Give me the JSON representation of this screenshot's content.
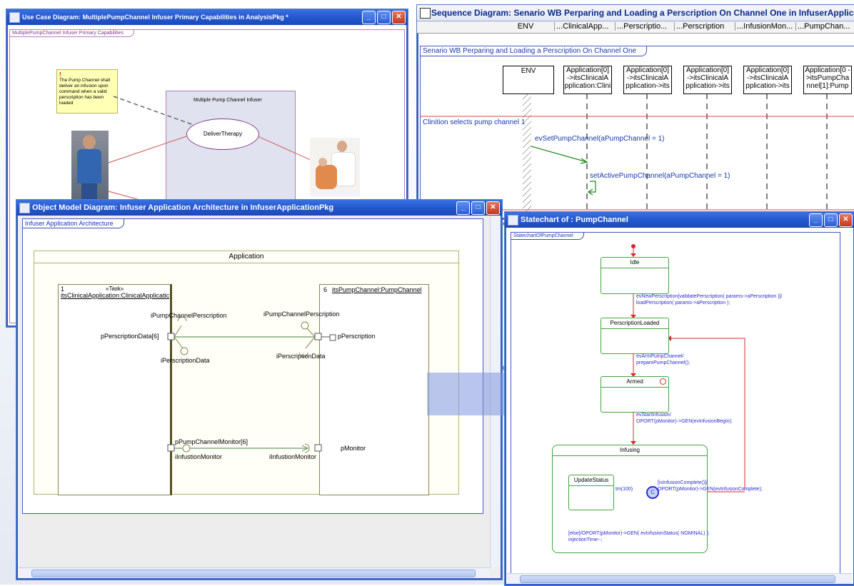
{
  "usecase": {
    "title": "Use Case Diagram: MultiplePumpChannel Infuser Primary Capabilities in AnalysisPkg *",
    "frame_label": "MultiplePumpChannel Infuser Primary Capabilities",
    "note": "The Pump Channel shall deliver an infusion upon command when a valid perscription has been loaded",
    "system_label": "Multiple Pump Channel Infuser",
    "usecase_label": "DeliverTherapy"
  },
  "sequence": {
    "title": "Sequence Diagram: Senario WB Perparing and Loading a Perscription On Channel One in InfuserApplicat",
    "header_cols": [
      "ENV",
      "...ClinicalApp...",
      "...Perscriptio...",
      "...Perscription",
      "...InfusionMon...",
      "...PumpChan..."
    ],
    "frame_label": "Senario WB Perparing and Loading a Perscription On Channel One",
    "env": "ENV",
    "lifelines": [
      "Application[0] ->itsClinicalA pplication:Clini",
      "Application[0] ->itsClinicalA pplication->its",
      "Application[0] ->itsClinicalA pplication->its",
      "Application[0] ->itsClinicalA pplication->its",
      "Application[0 ->itsPumpCha nnel[1]:Pump"
    ],
    "condition": "Clinition selects pump channel 1",
    "msg1": "evSetPumpChannel(aPumpChannel = 1)",
    "msg2": "setActivePumpChannel(aPumpChannel = 1)",
    "stub1": "tio",
    "stub2": "rip"
  },
  "objectmodel": {
    "title": "Object Model Diagram: Infuser Application Architecture in InfuserApplicationPkg",
    "frame_label": "Infuser Application Architecture",
    "app_label": "Application",
    "left_mult": "1",
    "left_stereo": "«Task»",
    "left_name": "itsClinicalApplication:ClinicalApplicatic",
    "right_mult": "6",
    "right_name": "itsPumpChannel:PumpChannel",
    "iPumpL": "iPumpChannelPerscription",
    "iPumpR": "iPumpChannelPerscription",
    "pPersData": "pPerscriptionData[6]",
    "iPersData": "iPerscriptionData",
    "iPerscriptionData": "iPerscriptionData",
    "pPerscription": "pPerscription",
    "pMonitorL": "pPumpChannelMonitor[6]",
    "iInfL": "iInfustionMonitor",
    "iInfR": "iInfustionMonitor",
    "pMonitor": "pMonitor"
  },
  "statechart": {
    "title": "Statechart of : PumpChannel",
    "frame_label": "StatechartOfPumpChannel",
    "s_idle": "Idle",
    "s_loaded": "PerscriptionLoaded",
    "s_armed": "Armed",
    "s_infusing": "Infusing",
    "s_update": "UpdateStatus",
    "t1a": "evNewPerscription[validatePerscription( params->aPerscription )]/",
    "t1b": "loadPerscription( params->aPerscription );",
    "t2a": "evArmPumpChannel/",
    "t2b": "preparePumpChannel();",
    "t3a": "evStartInfusion/",
    "t3b": "OPORT(pMonitor)->GEN(evInfusionBegin);",
    "t4": "tm(100)",
    "t5a": "[isInfusionComplete()]/",
    "t5b": "OPORT(pMonitor)->GEN(evInfusionComplete);",
    "t6a": "[else]/OPORT(pMonitor)->GEN( evInfusionStatus( NOMINAL) );",
    "t6b": "injectionTime--;",
    "cond": "C"
  },
  "colors": {
    "title_blue": "#2458d0",
    "state_green": "#41a63f",
    "transition_red": "#d42a2a",
    "label_blue": "#2b2bd6"
  }
}
